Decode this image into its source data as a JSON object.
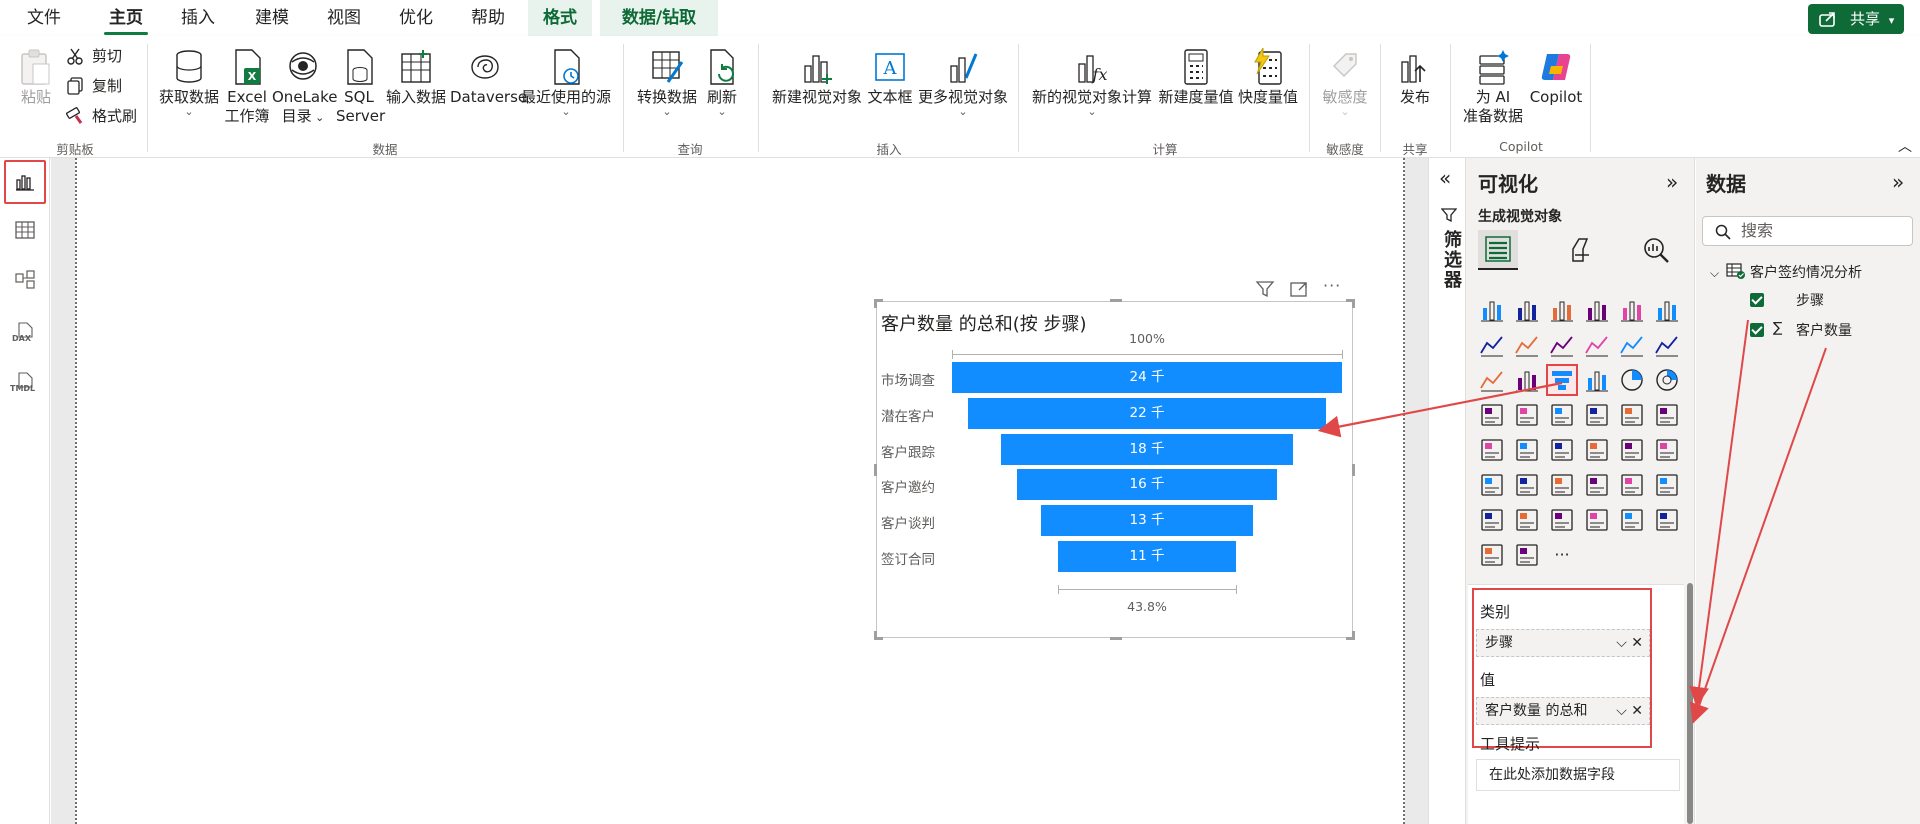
{
  "menu": {
    "items": [
      "文件",
      "主页",
      "插入",
      "建模",
      "视图",
      "优化",
      "帮助"
    ],
    "contextual": [
      "格式",
      "数据/钻取"
    ],
    "active": "主页",
    "share_label": "共享"
  },
  "ribbon": {
    "clipboard": {
      "paste": "粘贴",
      "cut": "剪切",
      "copy": "复制",
      "format_painter": "格式刷",
      "group": "剪贴板"
    },
    "data": {
      "get_data": "获取数据",
      "excel_1": "Excel",
      "excel_2": "工作簿",
      "onelake_1": "OneLake",
      "onelake_2": "目录",
      "sql_1": "SQL",
      "sql_2": "Server",
      "enter_data": "输入数据",
      "dataverse": "Dataverse",
      "recent": "最近使用的源",
      "group": "数据"
    },
    "query": {
      "transform": "转换数据",
      "refresh": "刷新",
      "group": "查询"
    },
    "insert": {
      "new_visual": "新建视觉对象",
      "textbox": "文本框",
      "more_visuals": "更多视觉对象",
      "group": "插入"
    },
    "calc": {
      "new_visual_calc": "新的视觉对象计算",
      "new_measure": "新建度量值",
      "quick_measure": "快度量值",
      "group": "计算"
    },
    "sensitivity": {
      "label": "敏感度",
      "group": "敏感度"
    },
    "share": {
      "publish": "发布",
      "group": "共享"
    },
    "copilot": {
      "ai_1": "为 AI",
      "ai_2": "准备数据",
      "copilot": "Copilot",
      "group": "Copilot"
    }
  },
  "rail": {
    "dax": "DAX",
    "tmdl": "TMDL"
  },
  "visual": {
    "title": "客户数量 的总和(按 步骤)",
    "top_pct": "100%",
    "bottom_pct": "43.8%"
  },
  "chart_data": {
    "type": "funnel",
    "title": "客户数量 的总和(按 步骤)",
    "categories": [
      "市场调查",
      "潜在客户",
      "客户跟踪",
      "客户邀约",
      "客户谈判",
      "签订合同"
    ],
    "values": [
      24,
      22,
      18,
      16,
      13,
      11
    ],
    "value_labels": [
      "24 千",
      "22 千",
      "18 千",
      "16 千",
      "13 千",
      "11 千"
    ],
    "conversion_top": "100%",
    "conversion_bottom": "43.8%",
    "color": "#118dff"
  },
  "filters": {
    "label": "筛选器"
  },
  "viz_pane": {
    "title": "可视化",
    "subtitle": "生成视觉对象",
    "category_label": "类别",
    "category_field": "步骤",
    "value_label": "值",
    "value_field": "客户数量 的总和",
    "tooltip_label": "工具提示",
    "tooltip_placeholder": "在此处添加数据字段",
    "more_icon": "···"
  },
  "data_pane": {
    "title": "数据",
    "search_placeholder": "搜索",
    "table_name": "客户签约情况分析",
    "fields": [
      "步骤",
      "客户数量"
    ]
  },
  "colors": {
    "accent": "#0e6b37",
    "bar": "#118dff",
    "highlight": "#e04848"
  }
}
